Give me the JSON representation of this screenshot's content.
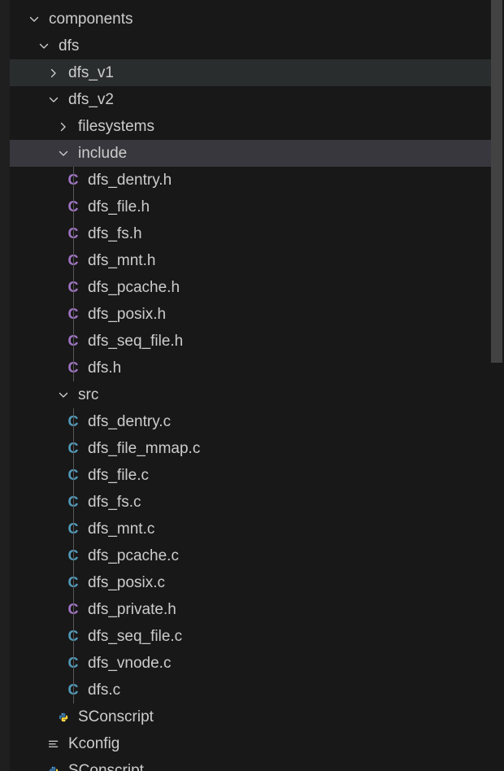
{
  "explorer": {
    "rows": [
      {
        "label": "components",
        "kind": "folder",
        "state": "open",
        "depth": 0,
        "row_state": "none"
      },
      {
        "label": "dfs",
        "kind": "folder",
        "state": "open",
        "depth": 1,
        "row_state": "none"
      },
      {
        "label": "dfs_v1",
        "kind": "folder",
        "state": "closed",
        "depth": 2,
        "row_state": "hover"
      },
      {
        "label": "dfs_v2",
        "kind": "folder",
        "state": "open",
        "depth": 2,
        "row_state": "none"
      },
      {
        "label": "filesystems",
        "kind": "folder",
        "state": "closed",
        "depth": 3,
        "row_state": "none"
      },
      {
        "label": "include",
        "kind": "folder",
        "state": "open",
        "depth": 3,
        "row_state": "selected"
      },
      {
        "label": "dfs_dentry.h",
        "kind": "h",
        "depth": 4,
        "row_state": "none"
      },
      {
        "label": "dfs_file.h",
        "kind": "h",
        "depth": 4,
        "row_state": "none"
      },
      {
        "label": "dfs_fs.h",
        "kind": "h",
        "depth": 4,
        "row_state": "none"
      },
      {
        "label": "dfs_mnt.h",
        "kind": "h",
        "depth": 4,
        "row_state": "none"
      },
      {
        "label": "dfs_pcache.h",
        "kind": "h",
        "depth": 4,
        "row_state": "none"
      },
      {
        "label": "dfs_posix.h",
        "kind": "h",
        "depth": 4,
        "row_state": "none"
      },
      {
        "label": "dfs_seq_file.h",
        "kind": "h",
        "depth": 4,
        "row_state": "none"
      },
      {
        "label": "dfs.h",
        "kind": "h",
        "depth": 4,
        "row_state": "none"
      },
      {
        "label": "src",
        "kind": "folder",
        "state": "open",
        "depth": 3,
        "row_state": "none"
      },
      {
        "label": "dfs_dentry.c",
        "kind": "c",
        "depth": 4,
        "row_state": "none"
      },
      {
        "label": "dfs_file_mmap.c",
        "kind": "c",
        "depth": 4,
        "row_state": "none"
      },
      {
        "label": "dfs_file.c",
        "kind": "c",
        "depth": 4,
        "row_state": "none"
      },
      {
        "label": "dfs_fs.c",
        "kind": "c",
        "depth": 4,
        "row_state": "none"
      },
      {
        "label": "dfs_mnt.c",
        "kind": "c",
        "depth": 4,
        "row_state": "none"
      },
      {
        "label": "dfs_pcache.c",
        "kind": "c",
        "depth": 4,
        "row_state": "none"
      },
      {
        "label": "dfs_posix.c",
        "kind": "c",
        "depth": 4,
        "row_state": "none"
      },
      {
        "label": "dfs_private.h",
        "kind": "h",
        "depth": 4,
        "row_state": "none"
      },
      {
        "label": "dfs_seq_file.c",
        "kind": "c",
        "depth": 4,
        "row_state": "none"
      },
      {
        "label": "dfs_vnode.c",
        "kind": "c",
        "depth": 4,
        "row_state": "none"
      },
      {
        "label": "dfs.c",
        "kind": "c",
        "depth": 4,
        "row_state": "none"
      },
      {
        "label": "SConscript",
        "kind": "python",
        "depth": 3,
        "row_state": "none"
      },
      {
        "label": "Kconfig",
        "kind": "kconfig",
        "depth": 2,
        "row_state": "none"
      },
      {
        "label": "SConscript",
        "kind": "python",
        "depth": 2,
        "row_state": "none"
      }
    ]
  },
  "icons": {
    "c_glyph": "C",
    "h_color": "#a074c4",
    "c_color": "#519aba",
    "python_blue": "#3572a5",
    "python_yellow": "#ffd43b"
  },
  "theme": {
    "background": "#181818",
    "hover": "#2a2d2e",
    "selected": "#37373d",
    "text": "#cccccc",
    "indent_guide": "#585858"
  }
}
